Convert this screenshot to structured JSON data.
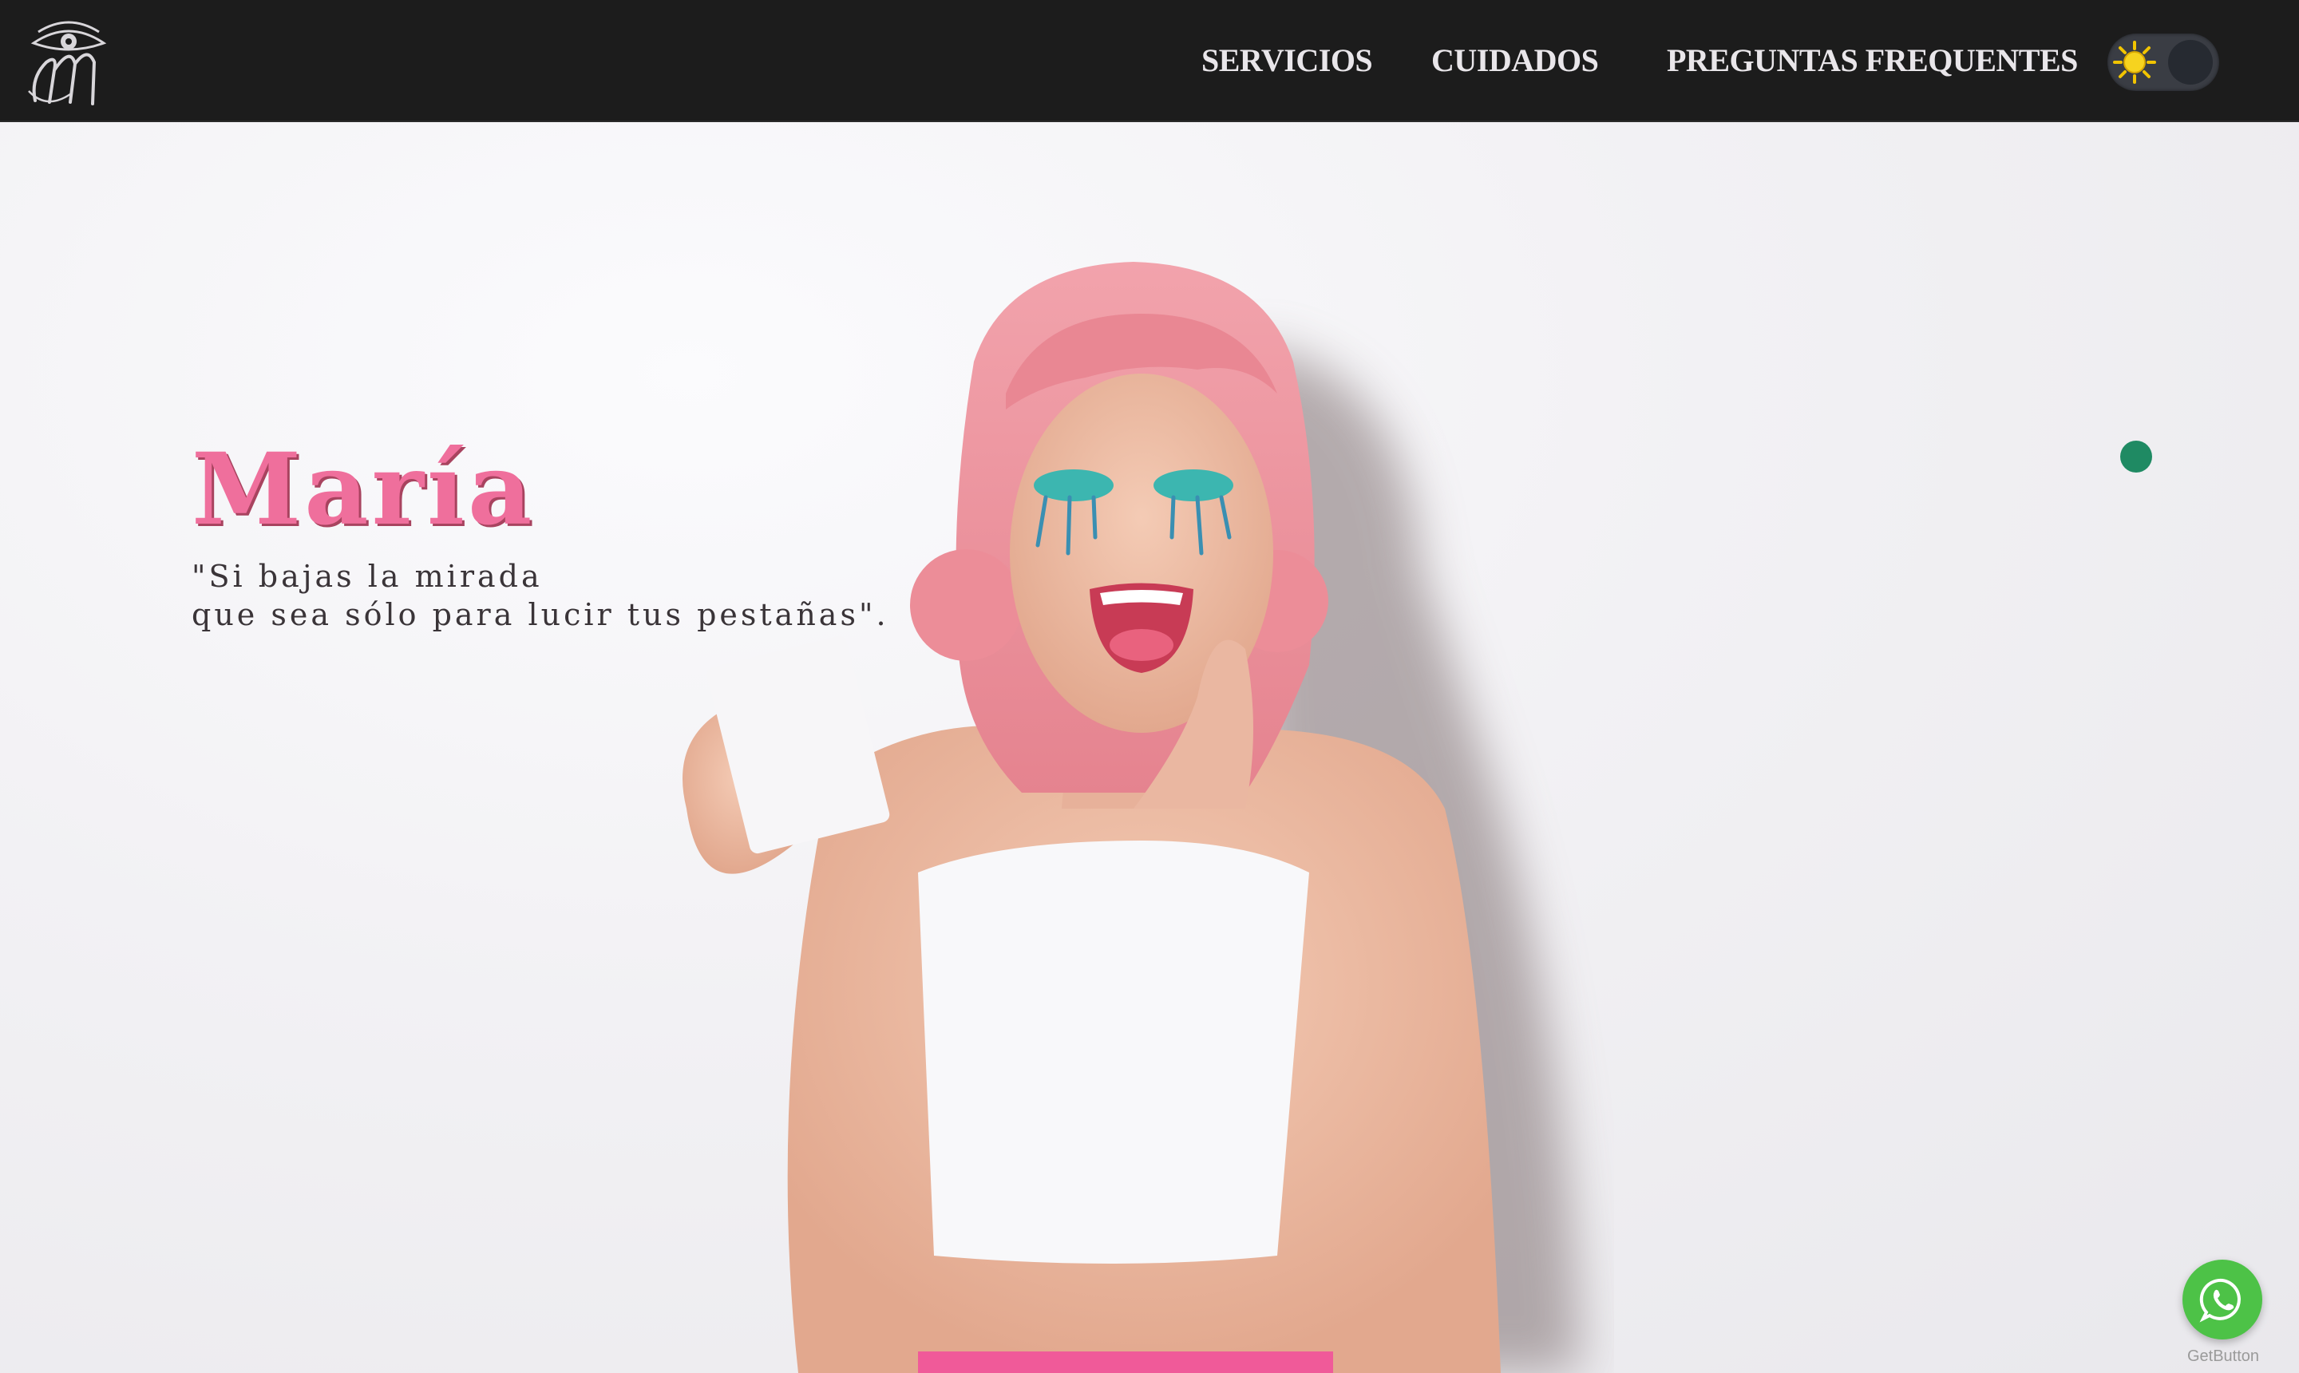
{
  "header": {
    "logo_name": "eye-monogram-logo",
    "nav": [
      {
        "label": "SERVICIOS"
      },
      {
        "label": "CUIDADOS"
      },
      {
        "label": "PREGUNTAS FREQUENTES"
      }
    ],
    "theme_toggle": {
      "icon": "sun-icon",
      "state": "light"
    }
  },
  "hero": {
    "title": "María",
    "quote_line1": "\"Si bajas la mirada",
    "quote_line2": "que sea sólo para lucir tus pestañas\".",
    "photo": "smiling woman with pink wig and glitter eye makeup holding a card",
    "accent_color": "#ef6f9c"
  },
  "floating": {
    "dot_color": "#1f8a63",
    "whatsapp": {
      "icon": "whatsapp-icon",
      "caption": "GetButton",
      "color": "#4dc247"
    }
  }
}
